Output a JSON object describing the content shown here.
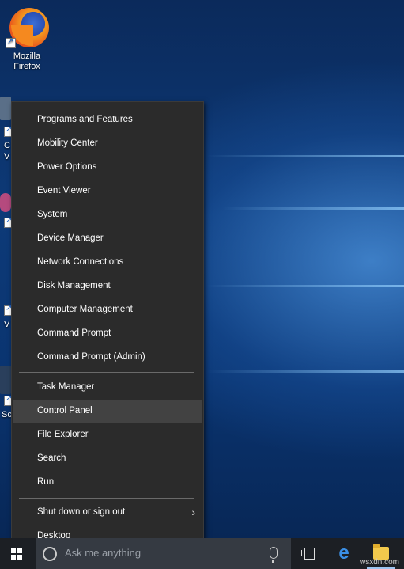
{
  "desktop": {
    "firefox_label": [
      "Mozilla",
      "Firefox"
    ],
    "partial_labels": [
      "C",
      "V",
      "V",
      "Sc"
    ]
  },
  "context_menu": {
    "group1": [
      "Programs and Features",
      "Mobility Center",
      "Power Options",
      "Event Viewer",
      "System",
      "Device Manager",
      "Network Connections",
      "Disk Management",
      "Computer Management",
      "Command Prompt",
      "Command Prompt (Admin)"
    ],
    "group2": [
      "Task Manager",
      "Control Panel",
      "File Explorer",
      "Search",
      "Run"
    ],
    "group3": [
      "Shut down or sign out",
      "Desktop"
    ],
    "hovered_item": "Control Panel"
  },
  "taskbar": {
    "search_placeholder": "Ask me anything"
  },
  "watermark": "wsxdn.com",
  "icons": [
    "firefox-icon",
    "windows-logo-icon",
    "cortana-icon",
    "microphone-icon",
    "task-view-icon",
    "edge-icon",
    "file-explorer-icon",
    "chevron-right-icon",
    "mouse-cursor-icon"
  ]
}
